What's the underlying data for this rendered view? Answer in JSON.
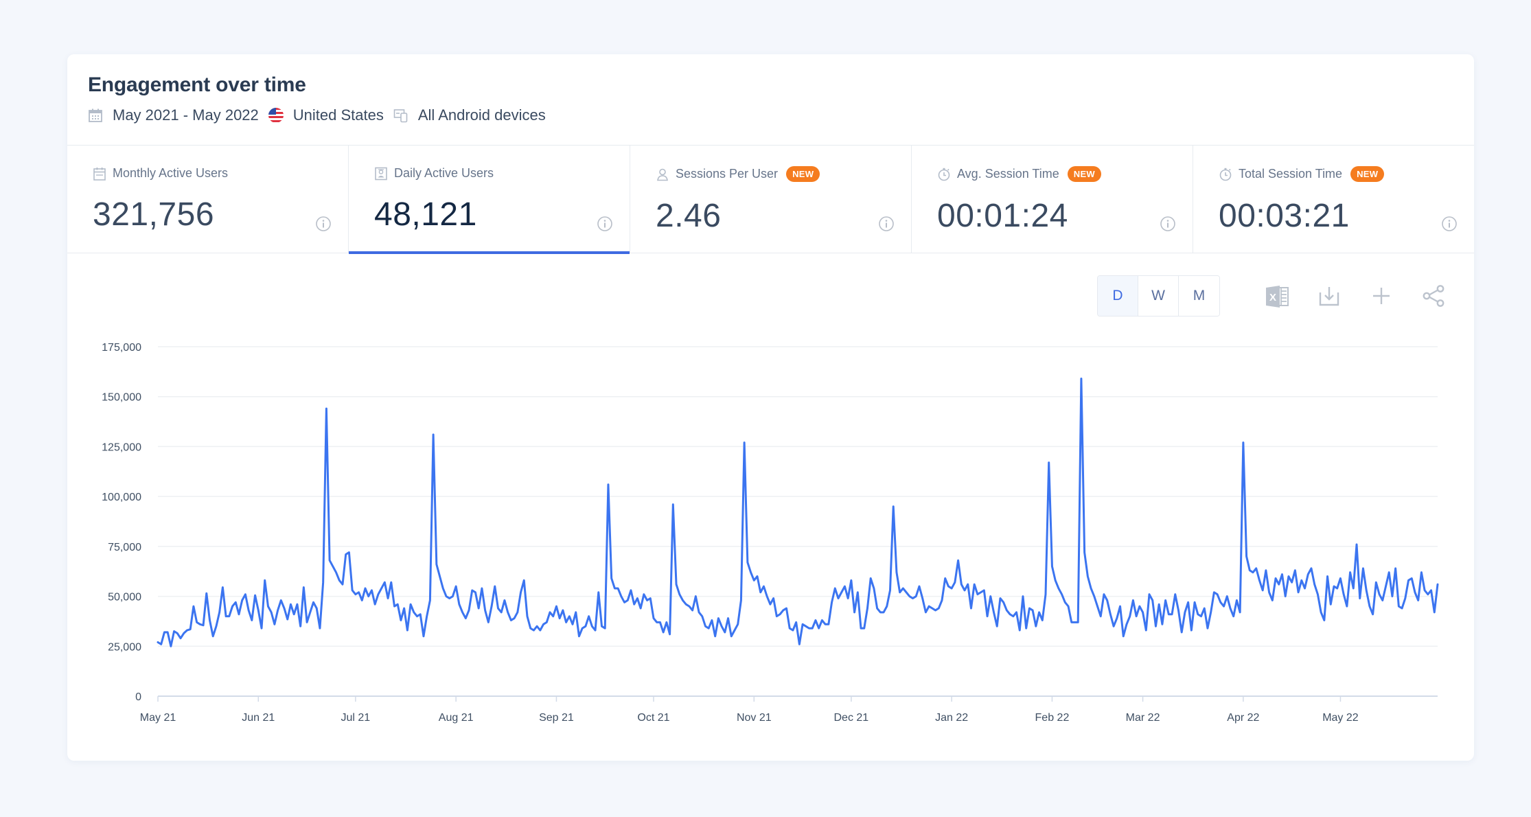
{
  "header": {
    "title": "Engagement over time",
    "filters": [
      {
        "icon": "calendar-icon",
        "label": "May 2021 - May 2022"
      },
      {
        "icon": "us-flag-icon",
        "label": "United States"
      },
      {
        "icon": "devices-icon",
        "label": "All Android devices"
      }
    ]
  },
  "metrics": [
    {
      "label": "Monthly Active Users",
      "value": "321,756",
      "icon": "calendar-icon",
      "badge": null,
      "active": false
    },
    {
      "label": "Daily Active Users",
      "value": "48,121",
      "icon": "user-card-icon",
      "badge": null,
      "active": true
    },
    {
      "label": "Sessions Per User",
      "value": "2.46",
      "icon": "user-icon",
      "badge": "NEW",
      "active": false
    },
    {
      "label": "Avg. Session Time",
      "value": "00:01:24",
      "icon": "stopwatch-icon",
      "badge": "NEW",
      "active": false
    },
    {
      "label": "Total Session Time",
      "value": "00:03:21",
      "icon": "stopwatch-icon",
      "badge": "NEW",
      "active": false
    }
  ],
  "toolbar": {
    "granularity": [
      {
        "label": "D",
        "active": true
      },
      {
        "label": "W",
        "active": false
      },
      {
        "label": "M",
        "active": false
      }
    ],
    "tools": [
      "excel-export-icon",
      "download-icon",
      "plus-icon",
      "share-icon"
    ]
  },
  "colors": {
    "accent": "#3e6ae1",
    "line": "#3b74f0",
    "badge": "#f57c1f",
    "background": "#f4f7fc"
  },
  "chart_data": {
    "type": "line",
    "title": "",
    "xlabel": "",
    "ylabel": "",
    "granularity": "daily",
    "start_date": "2021-05-01",
    "end_date": "2022-05-31",
    "ylim": [
      0,
      175000
    ],
    "yticks": [
      0,
      25000,
      50000,
      75000,
      100000,
      125000,
      150000,
      175000
    ],
    "ytick_labels": [
      "0",
      "25,000",
      "50,000",
      "75,000",
      "100,000",
      "125,000",
      "150,000",
      "175,000"
    ],
    "xtick_labels": [
      "May 21",
      "Jun 21",
      "Jul 21",
      "Aug 21",
      "Sep 21",
      "Oct 21",
      "Nov 21",
      "Dec 21",
      "Jan 22",
      "Feb 22",
      "Mar 22",
      "Apr 22",
      "May 22"
    ],
    "grid": true,
    "legend": "none",
    "series": [
      {
        "name": "Daily Active Users",
        "months": [
          {
            "month": "May 21",
            "values": [
              27000,
              26000,
              32000,
              32000,
              25000,
              32500,
              31500,
              29000,
              31500,
              33000,
              33500,
              45000,
              37000,
              36000,
              35500,
              51500,
              38000,
              30000,
              35000,
              42000,
              54500,
              40000,
              40000,
              45000,
              47000,
              41000,
              48000,
              51000,
              43000,
              38000,
              50500
            ]
          },
          {
            "month": "Jun 21",
            "values": [
              43000,
              34000,
              58000,
              45000,
              42000,
              36000,
              43000,
              48000,
              44000,
              38500,
              46000,
              41000,
              46000,
              35000,
              54500,
              37000,
              42000,
              47000,
              44000,
              34000,
              57000,
              144000,
              68000,
              65000,
              62000,
              58000,
              56000,
              71000,
              72000,
              53000
            ]
          },
          {
            "month": "Jul 21",
            "values": [
              51000,
              52000,
              48000,
              54000,
              50000,
              53000,
              46000,
              51000,
              54000,
              57000,
              49000,
              57000,
              45000,
              46000,
              38000,
              44000,
              33000,
              46000,
              42000,
              40000,
              41000,
              30000,
              40000,
              48000,
              131000,
              66000,
              60000,
              54000,
              50000,
              49000,
              50000
            ]
          },
          {
            "month": "Aug 21",
            "values": [
              55000,
              46000,
              42000,
              39000,
              43000,
              53000,
              52000,
              44000,
              54000,
              43000,
              37000,
              45000,
              55000,
              44000,
              42000,
              48000,
              42000,
              38000,
              39000,
              42000,
              52000,
              58000,
              40000,
              34000,
              33000,
              35000,
              33000,
              36000,
              37000,
              42000,
              40000
            ]
          },
          {
            "month": "Sep 21",
            "values": [
              45000,
              39000,
              43000,
              37000,
              40000,
              36000,
              42000,
              30000,
              34000,
              35000,
              40000,
              35000,
              33000,
              52000,
              35000,
              34000,
              106000,
              59000,
              54000,
              54000,
              50000,
              47000,
              48000,
              53000,
              46000,
              49000,
              44000,
              51000,
              48000,
              49000
            ]
          },
          {
            "month": "Oct 21",
            "values": [
              39000,
              37000,
              37000,
              32000,
              37000,
              31000,
              96000,
              56000,
              51000,
              48000,
              46000,
              45000,
              43000,
              50000,
              42000,
              40000,
              35000,
              34000,
              38000,
              30000,
              39000,
              35000,
              32000,
              39000,
              30000,
              33000,
              36000,
              48000,
              127000,
              67000,
              62000
            ]
          },
          {
            "month": "Nov 21",
            "values": [
              58000,
              60000,
              52000,
              55000,
              50000,
              46000,
              49000,
              40000,
              41000,
              43000,
              44000,
              34000,
              33000,
              37000,
              26000,
              36000,
              35000,
              34000,
              34000,
              38000,
              34000,
              38000,
              36000,
              36000,
              47000,
              54000,
              49000,
              52000,
              55000,
              49000
            ]
          },
          {
            "month": "Dec 21",
            "values": [
              58000,
              42000,
              52000,
              34000,
              34000,
              44000,
              59000,
              54000,
              44000,
              42000,
              42000,
              45000,
              53000,
              95000,
              62000,
              52000,
              54000,
              52000,
              50000,
              49000,
              50000,
              55000,
              49000,
              42000,
              45000,
              44000,
              43000,
              44000,
              48000,
              59000,
              55000
            ]
          },
          {
            "month": "Jan 22",
            "values": [
              54000,
              57000,
              68000,
              56000,
              53000,
              56000,
              44000,
              56000,
              51000,
              52000,
              53000,
              40000,
              50000,
              42000,
              35000,
              49000,
              47000,
              43000,
              41000,
              40000,
              42000,
              33000,
              50000,
              34000,
              44000,
              43000,
              35000,
              42000,
              38000,
              51000,
              117000
            ]
          },
          {
            "month": "Feb 22",
            "values": [
              65000,
              58000,
              54000,
              51000,
              47000,
              45000,
              37000,
              37000,
              37000,
              159000,
              72000,
              60000,
              54000,
              50000,
              45000,
              40000,
              51000,
              48000,
              41000,
              35000,
              39000,
              45000,
              30000,
              36000,
              40000,
              48000,
              40000,
              45000
            ]
          },
          {
            "month": "Mar 22",
            "values": [
              42000,
              33000,
              51000,
              48000,
              35000,
              46000,
              36000,
              48000,
              41000,
              41000,
              51000,
              43000,
              32000,
              42000,
              47000,
              33000,
              47000,
              41000,
              40000,
              44000,
              34000,
              42000,
              52000,
              51000,
              47000,
              45000,
              50000,
              44000,
              40000,
              48000,
              42000
            ]
          },
          {
            "month": "Apr 22",
            "values": [
              127000,
              70000,
              63000,
              62000,
              64000,
              58000,
              53000,
              63000,
              52000,
              48000,
              59000,
              56000,
              61000,
              50000,
              60000,
              57000,
              63000,
              52000,
              58000,
              54000,
              61000,
              64000,
              56000,
              51000,
              42000,
              38000,
              60000,
              46000,
              55000,
              54000
            ]
          },
          {
            "month": "May 22",
            "values": [
              59000,
              51000,
              45000,
              62000,
              54000,
              76000,
              49000,
              64000,
              53000,
              45000,
              41000,
              57000,
              51000,
              48000,
              55000,
              62000,
              50000,
              64000,
              45000,
              44000,
              49000,
              58000,
              59000,
              52000,
              48000,
              62000,
              53000,
              51000,
              53000,
              42000,
              56000
            ]
          }
        ]
      }
    ]
  }
}
